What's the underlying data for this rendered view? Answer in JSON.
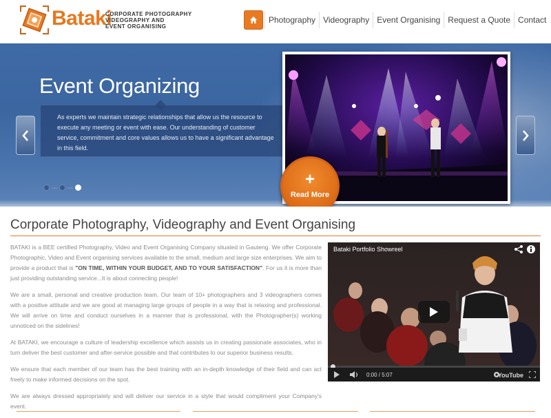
{
  "brand": {
    "name": "Bataki",
    "tagline": [
      "CORPORATE PHOTOGRAPHY",
      "VIDEOGRAPHY AND",
      "EVENT ORGANISING"
    ],
    "accent": "#e8771f"
  },
  "nav": {
    "home_icon": "home-icon",
    "items": [
      "Photography",
      "Videography",
      "Event Organising",
      "Request a Quote",
      "Contact"
    ]
  },
  "slider": {
    "title": "Event Organizing",
    "text": "As experts we maintain strategic relationships that allow us the resource to execute any meeting or event with ease. Our understanding of customer service, commitment and core values allows us to have a significant advantage in this field.",
    "read_more": "Read More",
    "slides_total": 3,
    "active_slide": 3
  },
  "main": {
    "title": "Corporate Photography, Videography and Event Organising",
    "paragraphs": {
      "p1_before": "BATAKI is a BEE certified Photography, Video and Event Organising Company situated in Gauteng. We offer Corporate Photographic, Video and Event organising services available to the small, medium and large size enterprises. We aim to provide a product that is ",
      "p1_bold": "\"ON TIME, WITHIN YOUR BUDGET, AND TO YOUR SATISFACTION\"",
      "p1_after": ". For us it is more than just providing outstanding service...It is about connecting people!",
      "p2": "We are a small, personal and creative production team. Our team of 10+ photographers and 3 videographers comes with a positive attitude and we are good at managing large groups of people in a way that is relaxing and professional. We will arrive on time and conduct ourselves in a manner that is professional, with the Photographer(s) working unnoticed on the sidelines!",
      "p3": " At BATAKI, we encourage a culture of leadership excellence which assists us in creating passionate associates, who in turn deliver the best customer and after-service possible and that contributes to our superior business results.",
      "p4": "We ensure that each member of our team has the best training with an in-depth knowledge of their field and can act freely to make informed decisions on the spot.",
      "p5": "We are always dressed appropriately and will deliver our service in a style that would compliment your Company's event."
    }
  },
  "video": {
    "title": "Bataki Portfolio Showreel",
    "time": "0:00 / 5:07",
    "logo": "YouTube"
  }
}
